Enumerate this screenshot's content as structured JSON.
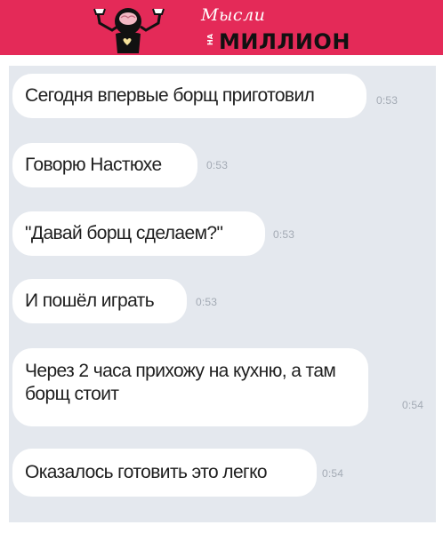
{
  "header": {
    "logo_script": "Мысли",
    "logo_prefix": "НА",
    "logo_main": "МИЛЛИОН",
    "colors": {
      "background": "#e42a58",
      "main_text": "#111111",
      "script_text": "#ffffff"
    }
  },
  "chat": {
    "messages": [
      {
        "text": "Сегодня впервые борщ приготовил",
        "time": "0:53"
      },
      {
        "text": "Говорю Настюхе",
        "time": "0:53"
      },
      {
        "text": "\"Давай борщ сделаем?\"",
        "time": "0:53"
      },
      {
        "text": "И пошёл играть",
        "time": "0:53"
      },
      {
        "text": "Через 2 часа прихожу на кухню, а там борщ стоит",
        "time": "0:54"
      },
      {
        "text": "Оказалось готовить это легко",
        "time": "0:54"
      }
    ],
    "colors": {
      "background": "#e4e8ee",
      "bubble": "#ffffff",
      "time": "#a3aab4"
    }
  }
}
